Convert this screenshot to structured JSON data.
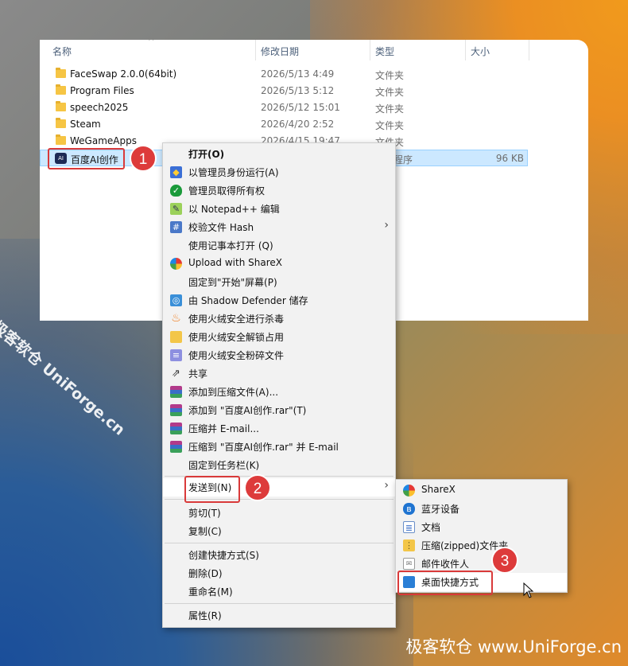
{
  "explorer": {
    "headers": {
      "name": "名称",
      "date": "修改日期",
      "type": "类型",
      "size": "大小"
    },
    "rows": [
      {
        "name": "FaceSwap 2.0.0(64bit)",
        "date": "2026/5/13 4:49",
        "type": "文件夹",
        "size": ""
      },
      {
        "name": "Program Files",
        "date": "2026/5/13 5:12",
        "type": "文件夹",
        "size": ""
      },
      {
        "name": "speech2025",
        "date": "2026/5/12 15:01",
        "type": "文件夹",
        "size": ""
      },
      {
        "name": "Steam",
        "date": "2026/4/20 2:52",
        "type": "文件夹",
        "size": ""
      },
      {
        "name": "WeGameApps",
        "date": "2026/4/15 19:47",
        "type": "文件夹",
        "size": ""
      },
      {
        "name": "百度AI创作",
        "date": "",
        "type": "程序",
        "size": "96 KB"
      }
    ]
  },
  "context_menu": {
    "items": [
      {
        "label": "打开(O)",
        "icon": "none",
        "bold": true
      },
      {
        "label": "以管理员身份运行(A)",
        "icon": "uac-shield-icon"
      },
      {
        "label": "管理员取得所有权",
        "icon": "green-shield-icon"
      },
      {
        "label": "以 Notepad++ 编辑",
        "icon": "notepadpp-icon"
      },
      {
        "label": "校验文件 Hash",
        "icon": "hash-icon",
        "submenu": true
      },
      {
        "label": "使用记事本打开 (Q)",
        "icon": "none"
      },
      {
        "label": "Upload with ShareX",
        "icon": "sharex-icon"
      },
      {
        "label": "固定到\"开始\"屏幕(P)",
        "icon": "none"
      },
      {
        "label": "由 Shadow Defender 储存",
        "icon": "shadow-defender-icon"
      },
      {
        "label": "使用火绒安全进行杀毒",
        "icon": "huorong-icon"
      },
      {
        "label": "使用火绒安全解锁占用",
        "icon": "folder-unlock-icon"
      },
      {
        "label": "使用火绒安全粉碎文件",
        "icon": "shredder-icon"
      },
      {
        "label": "共享",
        "icon": "share-icon"
      },
      {
        "label": "添加到压缩文件(A)...",
        "icon": "winrar-icon"
      },
      {
        "label": "添加到 \"百度AI创作.rar\"(T)",
        "icon": "winrar-icon"
      },
      {
        "label": "压缩并 E-mail...",
        "icon": "winrar-icon"
      },
      {
        "label": "压缩到 \"百度AI创作.rar\" 并 E-mail",
        "icon": "winrar-icon"
      },
      {
        "label": "固定到任务栏(K)",
        "icon": "none"
      },
      {
        "label": "发送到(N)",
        "icon": "none",
        "submenu": true
      },
      {
        "label": "剪切(T)",
        "icon": "none"
      },
      {
        "label": "复制(C)",
        "icon": "none"
      },
      {
        "label": "创建快捷方式(S)",
        "icon": "none"
      },
      {
        "label": "删除(D)",
        "icon": "none"
      },
      {
        "label": "重命名(M)",
        "icon": "none"
      },
      {
        "label": "属性(R)",
        "icon": "none"
      }
    ]
  },
  "send_to_menu": {
    "items": [
      {
        "label": "ShareX",
        "icon": "sharex-icon"
      },
      {
        "label": "蓝牙设备",
        "icon": "bluetooth-icon"
      },
      {
        "label": "文档",
        "icon": "document-icon"
      },
      {
        "label": "压缩(zipped)文件夹",
        "icon": "zip-folder-icon"
      },
      {
        "label": "邮件收件人",
        "icon": "mail-icon"
      },
      {
        "label": "桌面快捷方式",
        "icon": "desktop-icon"
      }
    ]
  },
  "steps": {
    "one": "1",
    "two": "2",
    "three": "3"
  },
  "watermark": {
    "diagonal": "极客软仓 UniForge.cn",
    "bottom": "极客软仓 www.UniForge.cn"
  }
}
